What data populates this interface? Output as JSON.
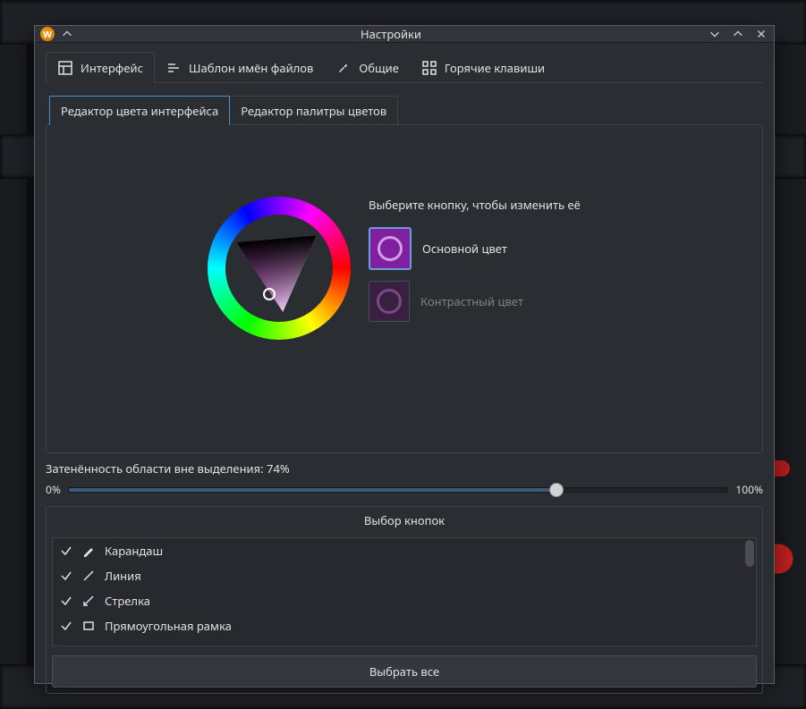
{
  "window": {
    "title": "Настройки",
    "app_icon_letter": "W"
  },
  "main_tabs": [
    {
      "id": "interface",
      "label": "Интерфейс",
      "active": true
    },
    {
      "id": "filename",
      "label": "Шаблон имён файлов",
      "active": false
    },
    {
      "id": "general",
      "label": "Общие",
      "active": false
    },
    {
      "id": "hotkeys",
      "label": "Горячие клавиши",
      "active": false
    }
  ],
  "sub_tabs": [
    {
      "id": "color-editor",
      "label": "Редактор цвета интерфейса",
      "active": true
    },
    {
      "id": "palette-editor",
      "label": "Редактор палитры цветов",
      "active": false
    }
  ],
  "color_picker": {
    "instruction": "Выберите кнопку, чтобы изменить её",
    "options": [
      {
        "id": "main",
        "label": "Основной цвет",
        "selected": true,
        "hex": "#9c27b0"
      },
      {
        "id": "contrast",
        "label": "Контрастный цвет",
        "selected": false,
        "hex": "#4a2a55"
      }
    ]
  },
  "shade": {
    "label_prefix": "Затенённость области вне выделения: ",
    "value": 74,
    "suffix": "%",
    "min_label": "0%",
    "max_label": "100%"
  },
  "button_group": {
    "title": "Выбор кнопок",
    "items": [
      {
        "id": "pencil",
        "label": "Карандаш",
        "checked": true
      },
      {
        "id": "line",
        "label": "Линия",
        "checked": true
      },
      {
        "id": "arrow",
        "label": "Стрелка",
        "checked": true
      },
      {
        "id": "rect",
        "label": "Прямоугольная рамка",
        "checked": true
      }
    ],
    "select_all": "Выбрать все"
  }
}
